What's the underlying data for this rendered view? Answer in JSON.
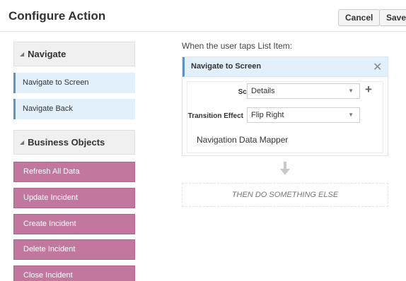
{
  "header": {
    "title": "Configure Action",
    "cancel_label": "Cancel",
    "save_label": "Save"
  },
  "sidebar": {
    "navigate": {
      "title": "Navigate",
      "items": [
        {
          "label": "Navigate to Screen"
        },
        {
          "label": "Navigate Back"
        }
      ]
    },
    "business_objects": {
      "title": "Business Objects",
      "items": [
        {
          "label": "Refresh All Data"
        },
        {
          "label": "Update Incident"
        },
        {
          "label": "Create Incident"
        },
        {
          "label": "Delete Incident"
        },
        {
          "label": "Close Incident"
        }
      ]
    }
  },
  "main": {
    "trigger_label": "When the user taps List Item:",
    "action": {
      "title": "Navigate to Screen",
      "close_icon": "close-icon",
      "fields": {
        "screen": {
          "label": "Screen",
          "value": "Details"
        },
        "transition": {
          "label": "Transition Effect",
          "value": "Flip Right"
        }
      },
      "mapper_label": "Navigation Data Mapper"
    },
    "then_label": "THEN DO SOMETHING ELSE"
  },
  "icons": {
    "collapse": "triangle-down-icon",
    "add": "plus-icon",
    "flow": "arrow-down-icon",
    "dropdown": "chevron-down-icon"
  },
  "colors": {
    "nav_item_bg": "#e1f0fb",
    "nav_item_accent": "#5e93c4",
    "bo_item_bg": "#c2789e"
  }
}
